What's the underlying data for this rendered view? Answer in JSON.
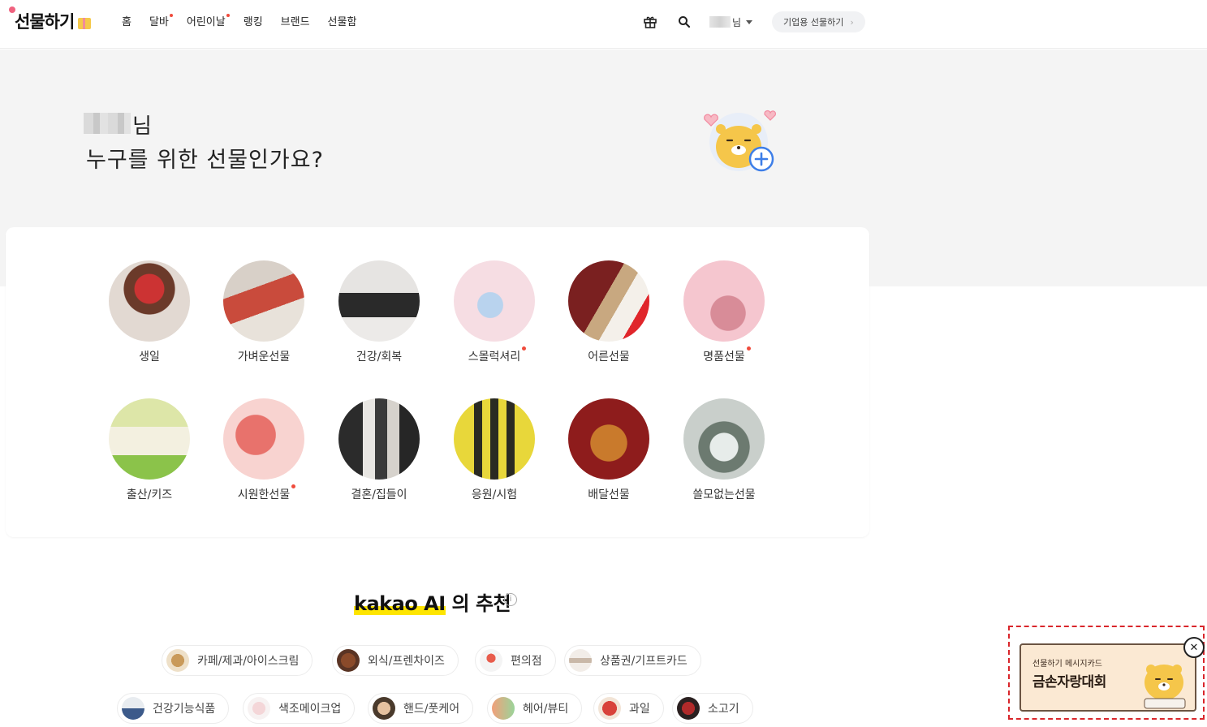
{
  "header": {
    "logo_text": "선물하기",
    "nav": [
      {
        "label": "홈",
        "active": true,
        "badge": false
      },
      {
        "label": "달바",
        "active": false,
        "badge": true
      },
      {
        "label": "어린이날",
        "active": false,
        "badge": true
      },
      {
        "label": "랭킹",
        "active": false,
        "badge": false
      },
      {
        "label": "브랜드",
        "active": false,
        "badge": false
      },
      {
        "label": "선물함",
        "active": false,
        "badge": false
      }
    ],
    "icons": [
      "gift-box-icon",
      "search-icon"
    ],
    "user_suffix": "님",
    "biz_button": "기업용 선물하기",
    "biz_chevron": "›"
  },
  "hero": {
    "name_suffix": "님",
    "question": "누구를 위한 선물인가요?"
  },
  "categories": [
    {
      "label": "생일",
      "badge": false
    },
    {
      "label": "가벼운선물",
      "badge": false
    },
    {
      "label": "건강/회복",
      "badge": false
    },
    {
      "label": "스몰럭셔리",
      "badge": true
    },
    {
      "label": "어른선물",
      "badge": false
    },
    {
      "label": "명품선물",
      "badge": true
    },
    {
      "label": "출산/키즈",
      "badge": false
    },
    {
      "label": "시원한선물",
      "badge": true
    },
    {
      "label": "결혼/집들이",
      "badge": false
    },
    {
      "label": "응원/시험",
      "badge": false
    },
    {
      "label": "배달선물",
      "badge": false
    },
    {
      "label": "쓸모없는선물",
      "badge": false
    }
  ],
  "ai": {
    "brand": "kakao AI",
    "suffix": " 의 추천",
    "info_glyph": "i"
  },
  "chips": [
    {
      "label": "카페/제과/아이스크림"
    },
    {
      "label": "외식/프렌차이즈"
    },
    {
      "label": "편의점"
    },
    {
      "label": "상품권/기프트카드"
    },
    {
      "label": "건강기능식품"
    },
    {
      "label": "색조메이크업"
    },
    {
      "label": "핸드/풋케어"
    },
    {
      "label": "헤어/뷰티"
    },
    {
      "label": "과일"
    },
    {
      "label": "소고기"
    }
  ],
  "float_banner": {
    "sub": "선물하기 메시지카드",
    "main": "금손자랑대회",
    "close_glyph": "✕"
  },
  "colors": {
    "accent_yellow": "#fee500",
    "badge_red": "#f04b3c",
    "hero_bg": "#f4f4f4",
    "banner_border": "#d9262b"
  }
}
